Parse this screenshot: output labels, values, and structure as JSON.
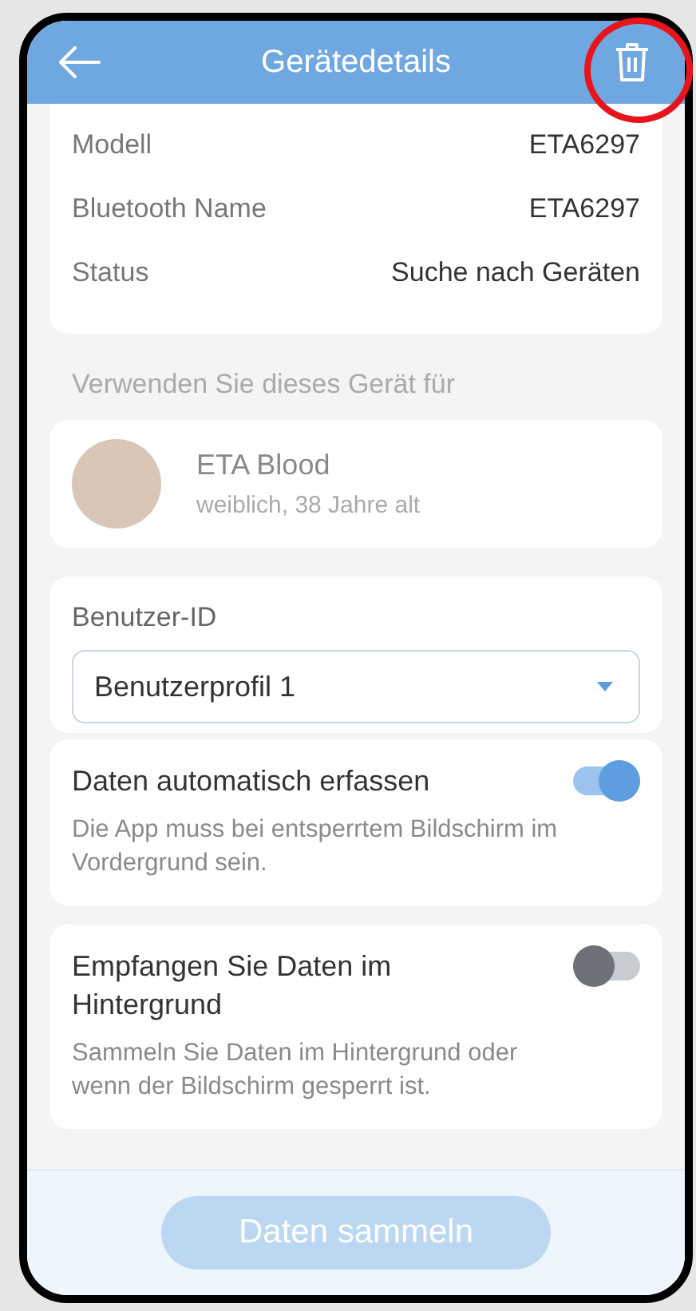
{
  "header": {
    "title": "Gerätedetails",
    "highlighted_action": true
  },
  "details": [
    {
      "label": "Modell",
      "value": "ETA6297"
    },
    {
      "label": "Bluetooth Name",
      "value": "ETA6297"
    },
    {
      "label": "Status",
      "value": "Suche nach Geräten"
    }
  ],
  "section_label": "Verwenden Sie dieses Gerät für",
  "profile": {
    "name": "ETA Blood",
    "info": "weiblich, 38 Jahre alt"
  },
  "user_id": {
    "label": "Benutzer-ID",
    "value": "Benutzerprofil 1"
  },
  "settings": [
    {
      "kind": "toggle",
      "title": "Daten automatisch erfassen",
      "description": "Die App muss bei entsperrtem Bildschirm im Vordergrund sein.",
      "on": true
    },
    {
      "kind": "toggle",
      "title": "Empfangen Sie Daten im Hintergrund",
      "description": "Sammeln Sie Daten im Hintergrund oder wenn der Bildschirm gesperrt ist.",
      "on": false
    }
  ],
  "action_button": {
    "label": "Daten sammeln",
    "disabled": true
  }
}
